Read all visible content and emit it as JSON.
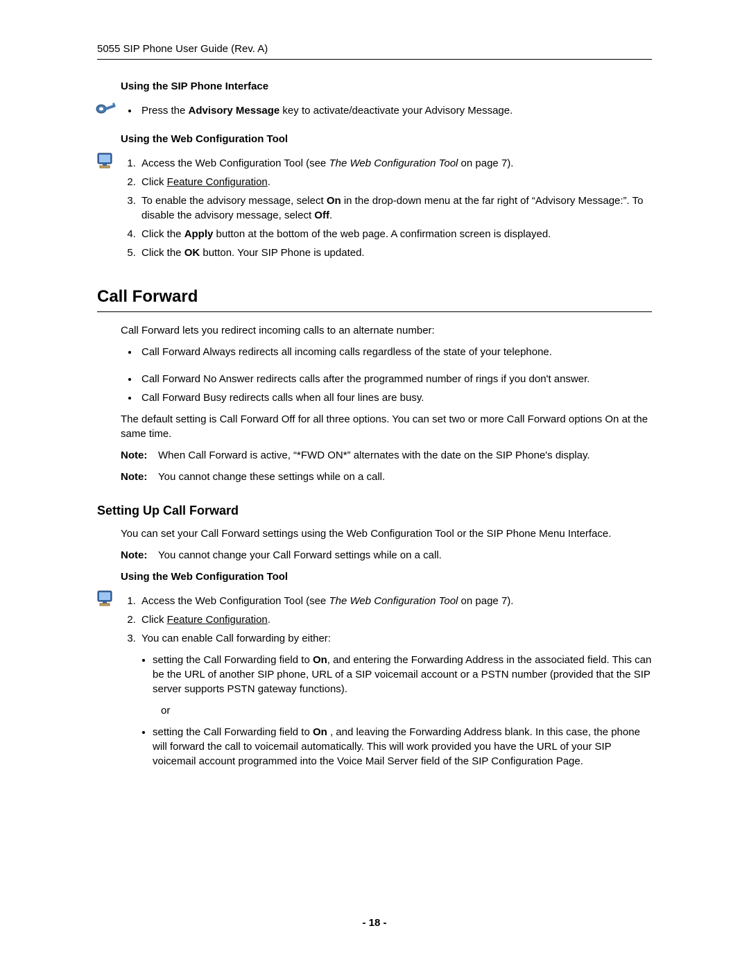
{
  "header": "5055 SIP Phone User Guide (Rev. A)",
  "sections": {
    "sip_interface_heading": "Using the SIP Phone Interface",
    "sip_interface_bullet_pre": "Press the ",
    "sip_interface_bullet_bold": "Advisory Message",
    "sip_interface_bullet_post": " key to activate/deactivate your Advisory Message.",
    "web_tool_heading": "Using the Web Configuration Tool",
    "web_steps": {
      "s1_pre": "Access the Web Configuration Tool (see ",
      "s1_italic": "The Web Configuration Tool",
      "s1_post": " on page 7).",
      "s2_pre": "Click ",
      "s2_link": "Feature Configuration",
      "s2_post": ".",
      "s3_pre": "To enable the advisory message, select ",
      "s3_on": "On",
      "s3_mid": " in the drop-down menu at the far right of “Advisory Message:”. To disable the advisory message, select ",
      "s3_off": "Off",
      "s3_post": ".",
      "s4_pre": "Click the ",
      "s4_bold": "Apply",
      "s4_post": " button at the bottom of the web page. A confirmation screen is displayed.",
      "s5_pre": "Click the ",
      "s5_bold": "OK",
      "s5_post": " button. Your SIP Phone is updated."
    },
    "call_forward_heading": "Call Forward",
    "cf_intro": "Call Forward lets you redirect incoming calls to an alternate number:",
    "cf_bullets": {
      "b1": "Call Forward Always redirects all incoming calls regardless of the state of your telephone.",
      "b2": "Call Forward No Answer redirects calls after the programmed number of rings if you don't answer.",
      "b3": "Call Forward Busy redirects calls when all four lines are busy."
    },
    "cf_default": "The default setting is Call Forward Off for all three options. You can set two or more Call Forward options On at the same time.",
    "note_label": "Note:",
    "cf_note1": "When Call Forward is active, “*FWD ON*” alternates with the date on the SIP Phone's display.",
    "cf_note2": "You cannot change these settings while on a call.",
    "setting_up_heading": "Setting Up Call Forward",
    "su_intro": "You can set your Call Forward settings using the Web Configuration Tool or the SIP Phone Menu Interface.",
    "su_note": "You cannot change your Call Forward settings while on a call.",
    "web_tool_heading2": "Using the Web Configuration Tool",
    "su_steps": {
      "s1_pre": "Access the Web Configuration Tool (see ",
      "s1_italic": "The Web Configuration Tool",
      "s1_post": " on page 7).",
      "s2_pre": "Click ",
      "s2_link": "Feature Configuration",
      "s2_post": ".",
      "s3": "You can enable Call forwarding by either:",
      "sub1_pre": "setting the Call Forwarding field to ",
      "sub1_bold": "On",
      "sub1_post": ", and entering the Forwarding Address in the associated field. This can be the URL of another SIP phone, URL of a SIP voicemail account or a PSTN number (provided that the SIP server supports PSTN gateway functions).",
      "or": "or",
      "sub2_pre": "setting the Call Forwarding field to ",
      "sub2_bold": "On",
      "sub2_post": " , and leaving the Forwarding Address blank. In this case, the phone will forward the call to voicemail automatically. This will work provided you have the URL of your SIP voicemail account programmed into the Voice Mail Server field of the SIP Configuration Page."
    }
  },
  "footer": "- 18 -"
}
